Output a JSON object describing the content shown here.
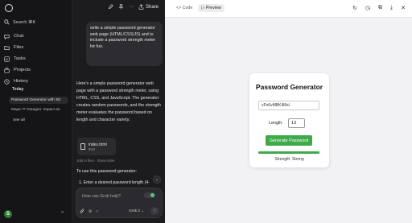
{
  "sidebar": {
    "search_label": "Search ⌘K",
    "items": [
      {
        "label": "Chat",
        "icon": "chat-icon"
      },
      {
        "label": "Files",
        "icon": "folder-icon"
      },
      {
        "label": "Tasks",
        "icon": "tasks-icon"
      },
      {
        "label": "Projects",
        "icon": "projects-icon"
      },
      {
        "label": "History",
        "icon": "history-icon"
      }
    ],
    "section_title": "Today",
    "history": [
      "Password Generator with Str",
      "Major IT Outages: Impact an"
    ],
    "see_all": "See all",
    "avatar_initial": "S"
  },
  "chat": {
    "share_label": "Share",
    "user_message": "write a simple password generator web page (HTML/CSS/JS) and to include a password strength meter for fun.",
    "reply": "Here's a simple password generator web page with a password strength meter, using HTML, CSS, and JavaScript. The generator creates random passwords, and the strength meter evaluates the password based on length and character variety.",
    "file": {
      "name": "index.html",
      "type": "html"
    },
    "file_actions": "Edit in files · Show inline",
    "to_use": "To use this password generator:",
    "step": "1.  Enter a desired password length (4-",
    "composer_placeholder": "How can Grok help?",
    "model": "Grok 3"
  },
  "preview": {
    "tabs": [
      {
        "label": "<> Code"
      },
      {
        "label": "▷ Preview"
      }
    ],
    "title": "Password Generator",
    "password": "cPz6vMBK4l8sl",
    "length_label": "Length:",
    "length_value": "13",
    "generate_label": "Generate Password",
    "strength_text": "Strength: Strong",
    "strength_fraction": 1.0
  },
  "colors": {
    "accent_green": "#3faa4a",
    "panel_bg": "#f2f2f4",
    "dark_bg": "#1c1c1e"
  }
}
